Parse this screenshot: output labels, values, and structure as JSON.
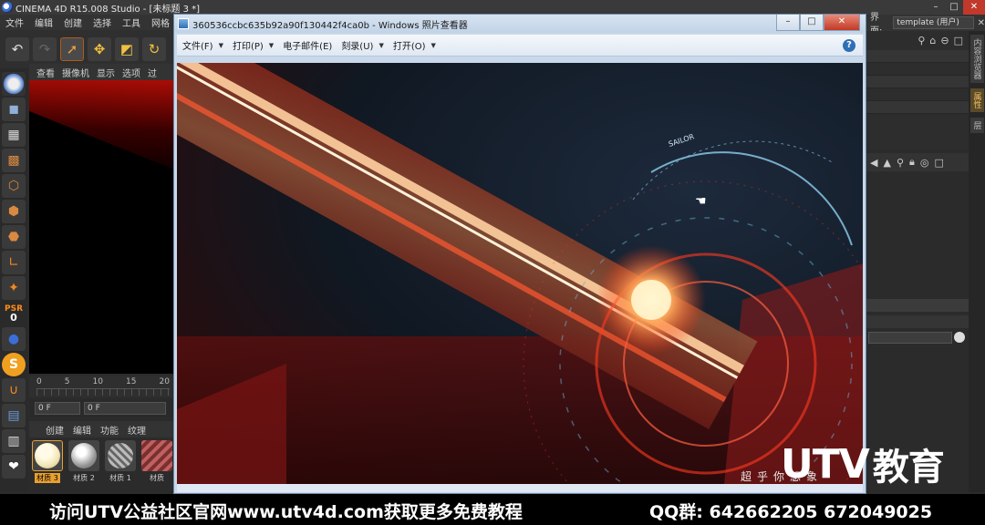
{
  "c4d": {
    "title": "CINEMA 4D R15.008 Studio - [未标题 3 *]",
    "menu": [
      "文件",
      "编辑",
      "创建",
      "选择",
      "工具",
      "网格",
      "捕"
    ],
    "viewport_menu": [
      "查看",
      "摄像机",
      "显示",
      "选项",
      "过"
    ],
    "timeline_ticks": [
      "0",
      "5",
      "10",
      "15",
      "20"
    ],
    "frame_start": "0 F",
    "frame_current": "0 F",
    "psr_label": "PSR",
    "psr_value": "0",
    "material_menu": [
      "创建",
      "编辑",
      "功能",
      "纹理"
    ],
    "materials": [
      {
        "label": "材质 3",
        "color": "#f3e6b8",
        "selected": true
      },
      {
        "label": "材质 2",
        "color": "#bdbdbd",
        "selected": false
      },
      {
        "label": "材质 1",
        "color": "#8c8c8c",
        "selected": false
      },
      {
        "label": "材质",
        "color": "#b04a4a",
        "selected": false
      }
    ],
    "layout_label": "界面:",
    "layout_value": "template (用户)",
    "side_tabs": [
      "内容浏览器",
      "属性",
      "层"
    ]
  },
  "photo_viewer": {
    "title": "360536ccbc635b92a90f130442f4ca0b - Windows 照片查看器",
    "menus": [
      {
        "label": "文件(F)"
      },
      {
        "label": "打印(P)"
      },
      {
        "label": "电子邮件(E)"
      },
      {
        "label": "刻录(U)"
      },
      {
        "label": "打开(O)"
      }
    ],
    "help_icon": "?",
    "image_text": "超乎你想象",
    "image_small_text": "SAILOR"
  },
  "watermark": {
    "logo": "UTV",
    "logo_suffix": "教育"
  },
  "banner": {
    "left": "访问UTV公益社区官网www.utv4d.com获取更多免费教程",
    "qq": "QQ群: 642662205   672049025"
  }
}
